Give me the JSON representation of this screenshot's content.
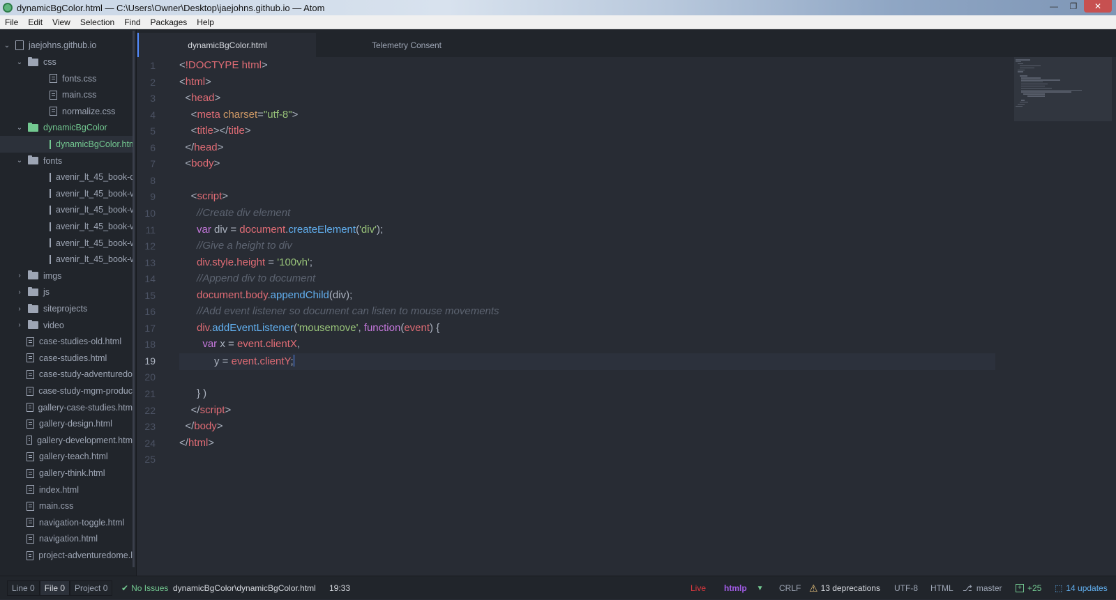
{
  "window": {
    "title": "dynamicBgColor.html — C:\\Users\\Owner\\Desktop\\jaejohns.github.io — Atom",
    "minimize": "—",
    "maximize": "❐",
    "close": "✕"
  },
  "menu": [
    "File",
    "Edit",
    "View",
    "Selection",
    "Find",
    "Packages",
    "Help"
  ],
  "tree": {
    "root": "jaejohns.github.io",
    "items": [
      {
        "label": "css",
        "type": "folder",
        "expanded": true,
        "depth": 1
      },
      {
        "label": "fonts.css",
        "type": "file",
        "depth": 2
      },
      {
        "label": "main.css",
        "type": "file",
        "depth": 2
      },
      {
        "label": "normalize.css",
        "type": "file",
        "depth": 2
      },
      {
        "label": "dynamicBgColor",
        "type": "folder",
        "expanded": true,
        "depth": 1,
        "status": "modified"
      },
      {
        "label": "dynamicBgColor.html",
        "type": "file",
        "depth": 2,
        "status": "modified",
        "selected": true
      },
      {
        "label": "fonts",
        "type": "folder",
        "expanded": true,
        "depth": 1
      },
      {
        "label": "avenir_lt_45_book-de",
        "type": "file",
        "depth": 2
      },
      {
        "label": "avenir_lt_45_book-we",
        "type": "file",
        "depth": 2
      },
      {
        "label": "avenir_lt_45_book-we",
        "type": "file",
        "depth": 2
      },
      {
        "label": "avenir_lt_45_book-we",
        "type": "file",
        "depth": 2
      },
      {
        "label": "avenir_lt_45_book-we",
        "type": "file",
        "depth": 2
      },
      {
        "label": "avenir_lt_45_book-we",
        "type": "file",
        "depth": 2
      },
      {
        "label": "imgs",
        "type": "folder",
        "expanded": false,
        "depth": 1
      },
      {
        "label": "js",
        "type": "folder",
        "expanded": false,
        "depth": 1
      },
      {
        "label": "siteprojects",
        "type": "folder",
        "expanded": false,
        "depth": 1
      },
      {
        "label": "video",
        "type": "folder",
        "expanded": false,
        "depth": 1
      },
      {
        "label": "case-studies-old.html",
        "type": "file",
        "depth": 1
      },
      {
        "label": "case-studies.html",
        "type": "file",
        "depth": 1
      },
      {
        "label": "case-study-adventuredo",
        "type": "file",
        "depth": 1
      },
      {
        "label": "case-study-mgm-produc",
        "type": "file",
        "depth": 1
      },
      {
        "label": "gallery-case-studies.htm",
        "type": "file",
        "depth": 1
      },
      {
        "label": "gallery-design.html",
        "type": "file",
        "depth": 1
      },
      {
        "label": "gallery-development.htm",
        "type": "file",
        "depth": 1
      },
      {
        "label": "gallery-teach.html",
        "type": "file",
        "depth": 1
      },
      {
        "label": "gallery-think.html",
        "type": "file",
        "depth": 1
      },
      {
        "label": "index.html",
        "type": "file",
        "depth": 1
      },
      {
        "label": "main.css",
        "type": "file",
        "depth": 1
      },
      {
        "label": "navigation-toggle.html",
        "type": "file",
        "depth": 1
      },
      {
        "label": "navigation.html",
        "type": "file",
        "depth": 1
      },
      {
        "label": "project-adventuredome.l",
        "type": "file",
        "depth": 1
      }
    ]
  },
  "tabs": [
    {
      "label": "dynamicBgColor.html",
      "active": true
    },
    {
      "label": "Telemetry Consent",
      "active": false
    }
  ],
  "editor": {
    "cursor_line": 19,
    "lines": [
      [
        [
          "p",
          "<"
        ],
        [
          "t",
          "!DOCTYPE html"
        ],
        [
          "p",
          ">"
        ]
      ],
      [
        [
          "p",
          "<"
        ],
        [
          "t",
          "html"
        ],
        [
          "p",
          ">"
        ]
      ],
      [
        [
          "p",
          "  <"
        ],
        [
          "t",
          "head"
        ],
        [
          "p",
          ">"
        ]
      ],
      [
        [
          "p",
          "    <"
        ],
        [
          "t",
          "meta "
        ],
        [
          "a",
          "charset"
        ],
        [
          "p",
          "="
        ],
        [
          "s",
          "\"utf-8\""
        ],
        [
          "p",
          ">"
        ]
      ],
      [
        [
          "p",
          "    <"
        ],
        [
          "t",
          "title"
        ],
        [
          "p",
          "></"
        ],
        [
          "t",
          "title"
        ],
        [
          "p",
          ">"
        ]
      ],
      [
        [
          "p",
          "  </"
        ],
        [
          "t",
          "head"
        ],
        [
          "p",
          ">"
        ]
      ],
      [
        [
          "p",
          "  <"
        ],
        [
          "t",
          "body"
        ],
        [
          "p",
          ">"
        ]
      ],
      [],
      [
        [
          "p",
          "    <"
        ],
        [
          "t",
          "script"
        ],
        [
          "p",
          ">"
        ]
      ],
      [
        [
          "c",
          "      //Create div element"
        ]
      ],
      [
        [
          "k",
          "      var "
        ],
        [
          "p",
          "div = "
        ],
        [
          "v",
          "document"
        ],
        [
          "p",
          "."
        ],
        [
          "f",
          "createElement"
        ],
        [
          "p",
          "("
        ],
        [
          "s",
          "'div'"
        ],
        [
          "p",
          ");"
        ]
      ],
      [
        [
          "c",
          "      //Give a height to div"
        ]
      ],
      [
        [
          "v",
          "      div"
        ],
        [
          "p",
          "."
        ],
        [
          "v",
          "style"
        ],
        [
          "p",
          "."
        ],
        [
          "v",
          "height"
        ],
        [
          "p",
          " = "
        ],
        [
          "s",
          "'100vh'"
        ],
        [
          "p",
          ";"
        ]
      ],
      [
        [
          "c",
          "      //Append div to document"
        ]
      ],
      [
        [
          "v",
          "      document"
        ],
        [
          "p",
          "."
        ],
        [
          "v",
          "body"
        ],
        [
          "p",
          "."
        ],
        [
          "f",
          "appendChild"
        ],
        [
          "p",
          "(div);"
        ]
      ],
      [
        [
          "c",
          "      //Add event listener so document can listen to mouse movements"
        ]
      ],
      [
        [
          "v",
          "      div"
        ],
        [
          "p",
          "."
        ],
        [
          "f",
          "addEventListener"
        ],
        [
          "p",
          "("
        ],
        [
          "s",
          "'mousemove'"
        ],
        [
          "p",
          ", "
        ],
        [
          "k",
          "function"
        ],
        [
          "p",
          "("
        ],
        [
          "v",
          "event"
        ],
        [
          "p",
          ") {"
        ]
      ],
      [
        [
          "k",
          "        var "
        ],
        [
          "p",
          "x = "
        ],
        [
          "v",
          "event"
        ],
        [
          "p",
          "."
        ],
        [
          "v",
          "clientX"
        ],
        [
          "p",
          ","
        ]
      ],
      [
        [
          "p",
          "            y = "
        ],
        [
          "v",
          "event"
        ],
        [
          "p",
          "."
        ],
        [
          "v",
          "clientY"
        ],
        [
          "p",
          ";"
        ]
      ],
      [],
      [
        [
          "p",
          "      } )"
        ]
      ],
      [
        [
          "p",
          "    </"
        ],
        [
          "t",
          "script"
        ],
        [
          "p",
          ">"
        ]
      ],
      [
        [
          "p",
          "  </"
        ],
        [
          "t",
          "body"
        ],
        [
          "p",
          ">"
        ]
      ],
      [
        [
          "p",
          "</"
        ],
        [
          "t",
          "html"
        ],
        [
          "p",
          ">"
        ]
      ],
      []
    ]
  },
  "status": {
    "line_tab": "Line 0",
    "file_tab": "File 0",
    "project_tab": "Project 0",
    "issues_icon": "check-icon",
    "issues": "No Issues",
    "path": "dynamicBgColor\\dynamicBgColor.html",
    "cursor": "19:33",
    "live": "Live",
    "grammar_tool": "htmlp",
    "line_ending": "CRLF",
    "deprecations": "13 deprecations",
    "encoding": "UTF-8",
    "language": "HTML",
    "branch": "master",
    "diff": "+25",
    "updates": "14 updates",
    "colors": {
      "live": "#e0383e",
      "htmlp": "#a35ce8",
      "green": "#73c991",
      "blue": "#61afef"
    }
  }
}
